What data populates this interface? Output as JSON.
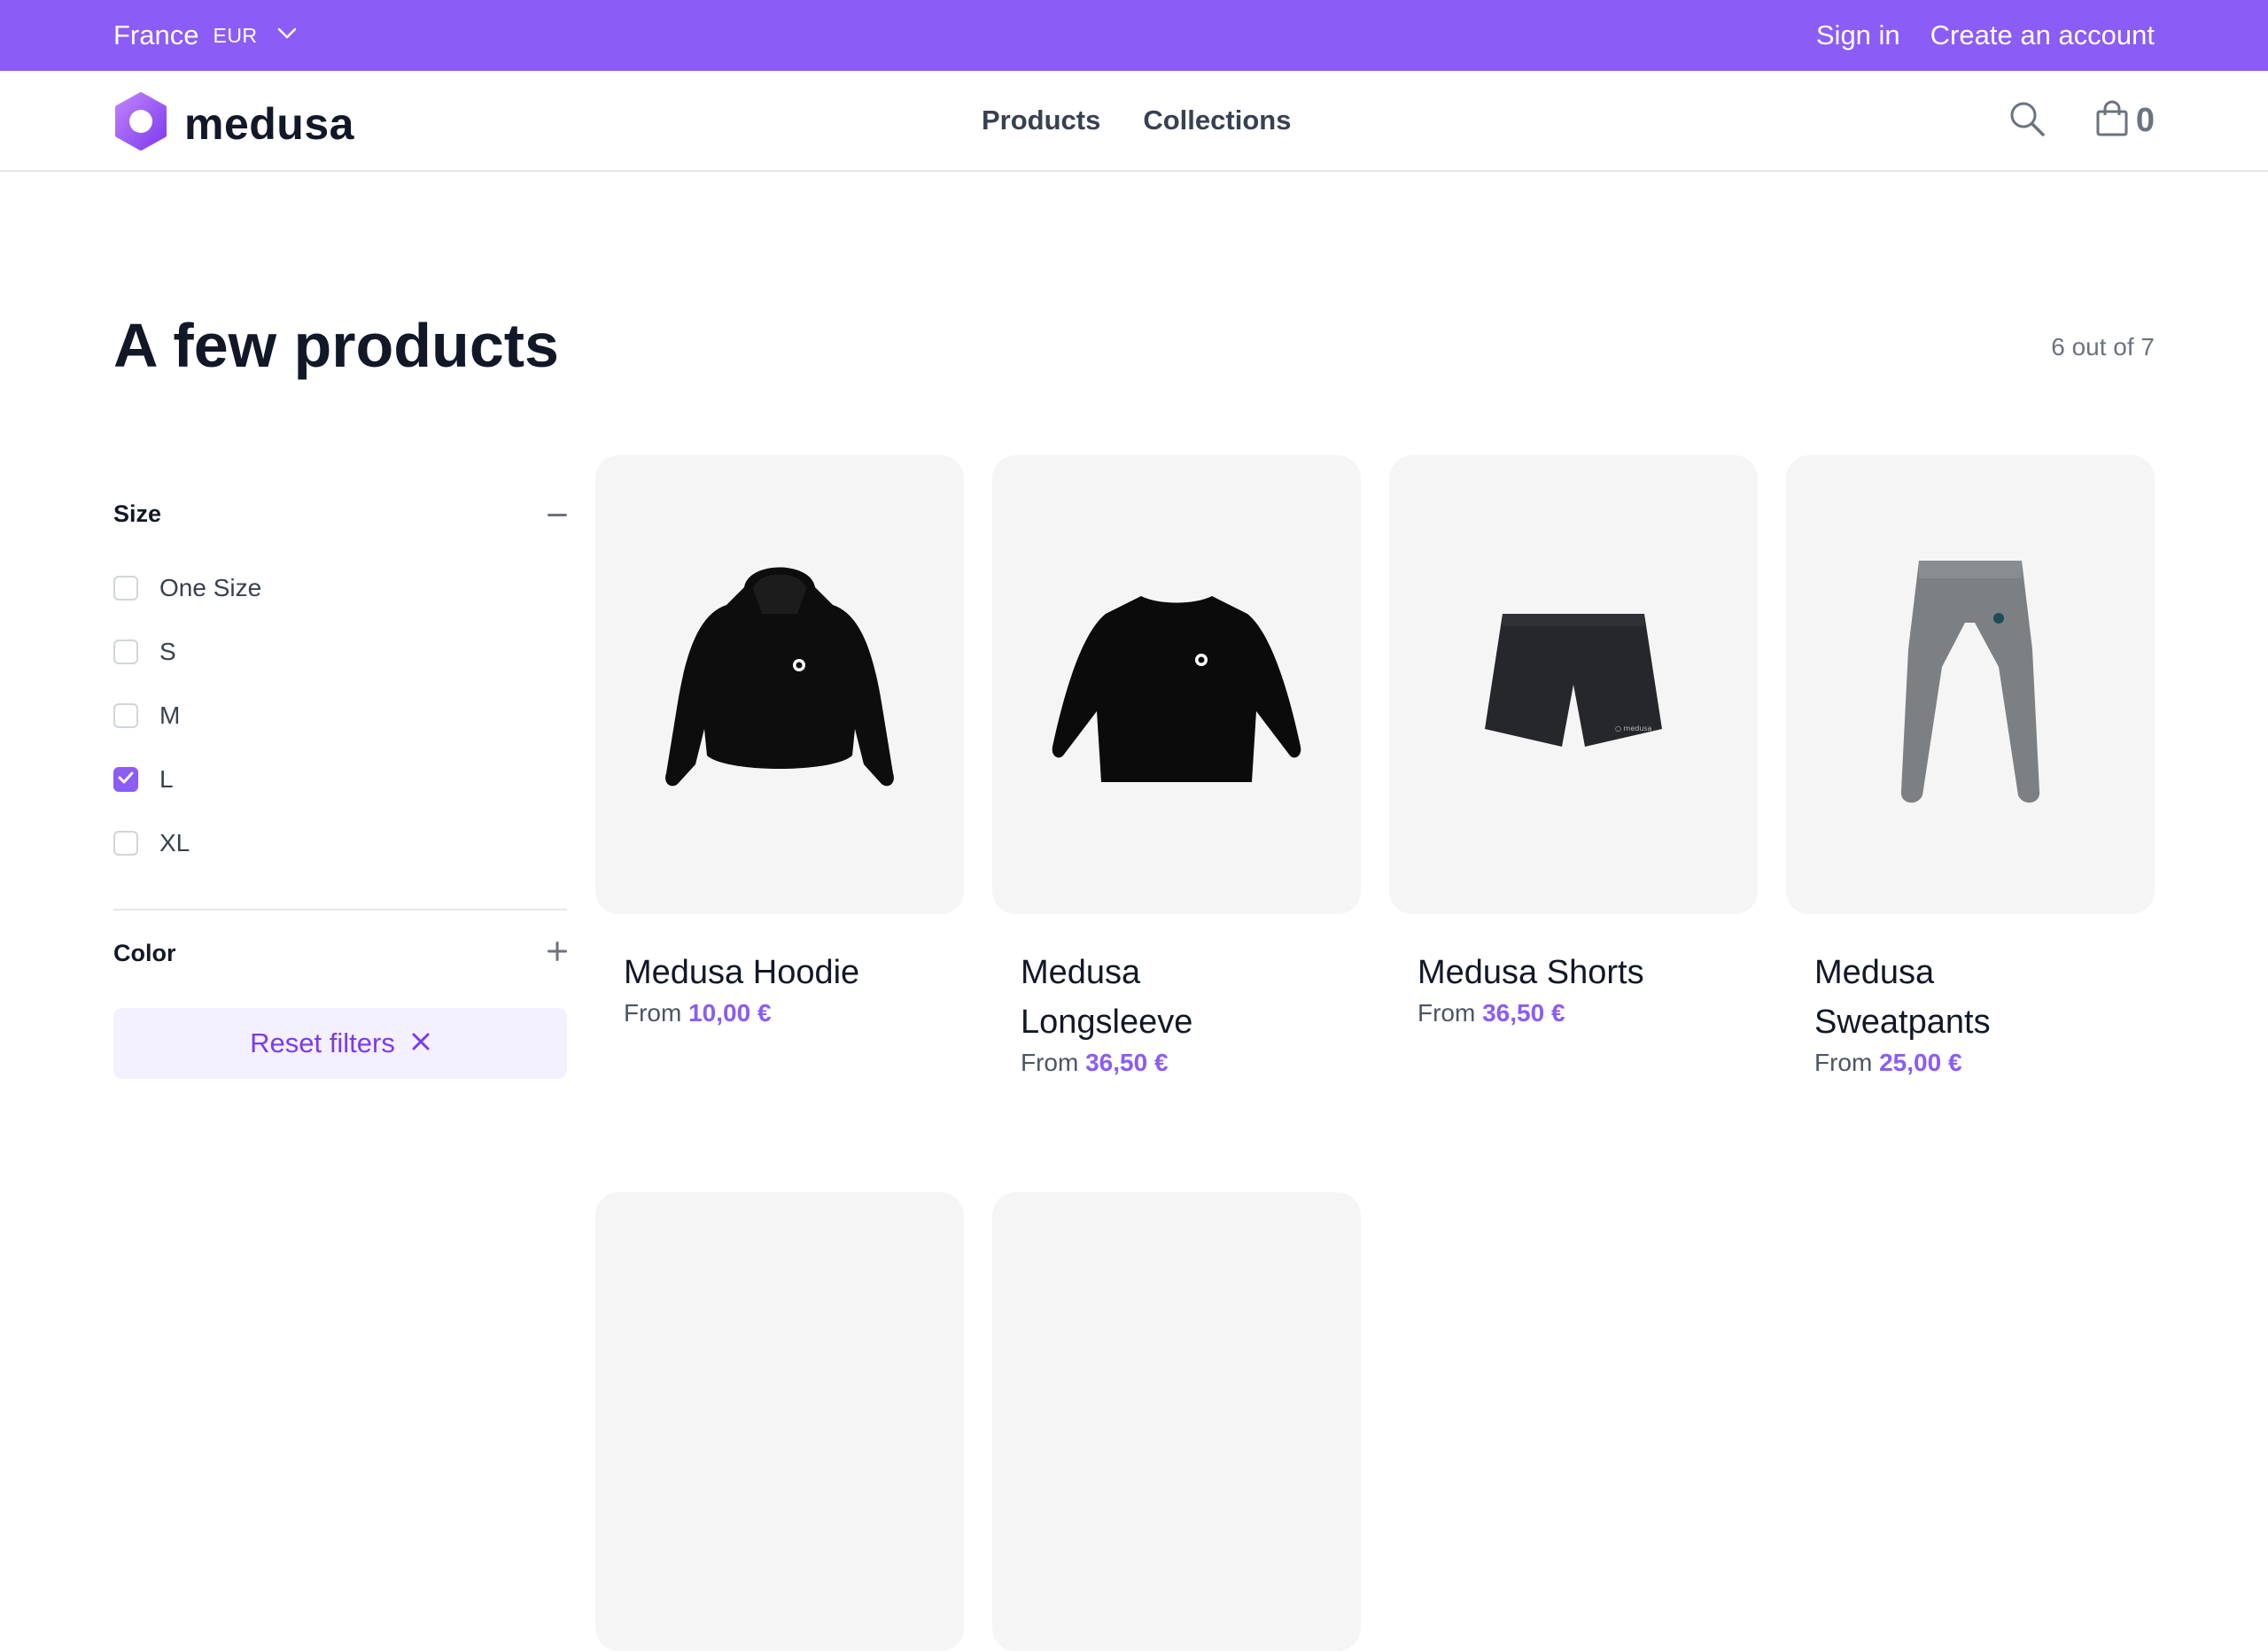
{
  "topbar": {
    "country": "France",
    "currency": "EUR",
    "sign_in": "Sign in",
    "create_account": "Create an account"
  },
  "nav": {
    "logo_text": "medusa",
    "links": [
      "Products",
      "Collections"
    ],
    "cart_count": "0"
  },
  "page": {
    "title": "A few products",
    "count": "6 out of 7"
  },
  "filters": {
    "size": {
      "title": "Size",
      "options": [
        {
          "label": "One Size",
          "checked": false
        },
        {
          "label": "S",
          "checked": false
        },
        {
          "label": "M",
          "checked": false
        },
        {
          "label": "L",
          "checked": true
        },
        {
          "label": "XL",
          "checked": false
        }
      ]
    },
    "color": {
      "title": "Color"
    },
    "reset_label": "Reset filters"
  },
  "products": [
    {
      "name": "Medusa Hoodie",
      "price_prefix": "From",
      "price": "10,00 €"
    },
    {
      "name": "Medusa Longsleeve",
      "price_prefix": "From",
      "price": "36,50 €"
    },
    {
      "name": "Medusa Shorts",
      "price_prefix": "From",
      "price": "36,50 €"
    },
    {
      "name": "Medusa Sweatpants",
      "price_prefix": "From",
      "price": "25,00 €"
    }
  ],
  "colors": {
    "brand": "#8b5cf6",
    "accent_text": "#7c3aed",
    "card_bg": "#f5f5f6"
  }
}
